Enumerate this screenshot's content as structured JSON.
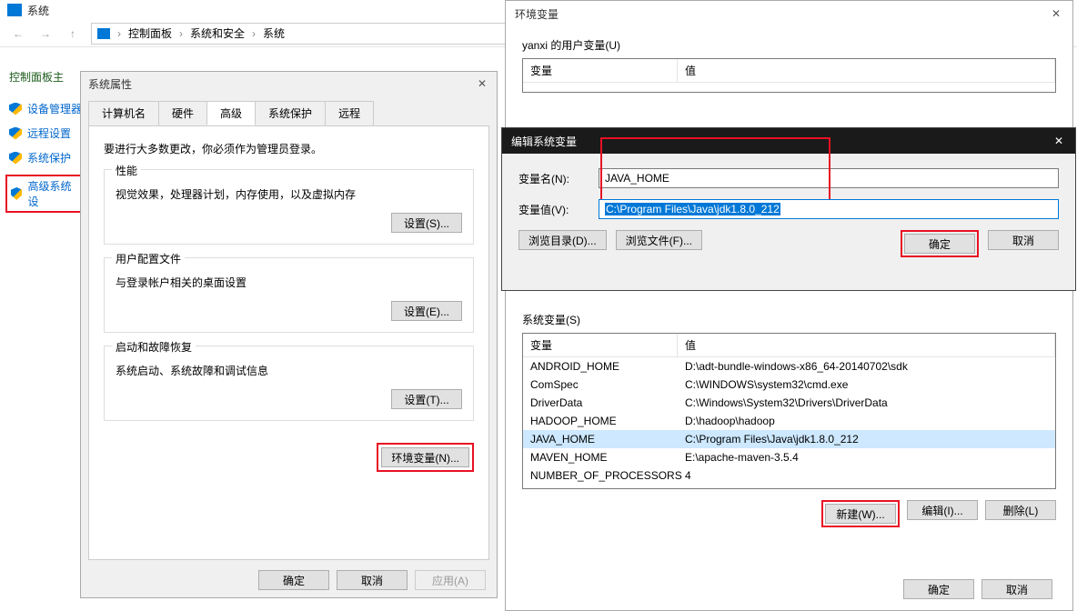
{
  "main": {
    "title": "系统",
    "path": [
      "控制面板",
      "系统和安全",
      "系统"
    ],
    "sidebar": {
      "heading": "控制面板主",
      "links": [
        "设备管理器",
        "远程设置",
        "系统保护",
        "高级系统设"
      ]
    }
  },
  "sysprops": {
    "title": "系统属性",
    "tabs": [
      "计算机名",
      "硬件",
      "高级",
      "系统保护",
      "远程"
    ],
    "notice": "要进行大多数更改，你必须作为管理员登录。",
    "groups": {
      "perf": {
        "title": "性能",
        "desc": "视觉效果，处理器计划，内存使用，以及虚拟内存",
        "btn": "设置(S)..."
      },
      "profile": {
        "title": "用户配置文件",
        "desc": "与登录帐户相关的桌面设置",
        "btn": "设置(E)..."
      },
      "startup": {
        "title": "启动和故障恢复",
        "desc": "系统启动、系统故障和调试信息",
        "btn": "设置(T)..."
      }
    },
    "env_btn": "环境变量(N)...",
    "ok": "确定",
    "cancel": "取消",
    "apply": "应用(A)"
  },
  "envvars": {
    "title": "环境变量",
    "user_section": "yanxi 的用户变量(U)",
    "col_name": "变量",
    "col_val": "值",
    "sys_section": "系统变量(S)",
    "sys_rows": [
      {
        "name": "ANDROID_HOME",
        "val": "D:\\adt-bundle-windows-x86_64-20140702\\sdk"
      },
      {
        "name": "ComSpec",
        "val": "C:\\WINDOWS\\system32\\cmd.exe"
      },
      {
        "name": "DriverData",
        "val": "C:\\Windows\\System32\\Drivers\\DriverData"
      },
      {
        "name": "HADOOP_HOME",
        "val": "D:\\hadoop\\hadoop"
      },
      {
        "name": "JAVA_HOME",
        "val": "C:\\Program Files\\Java\\jdk1.8.0_212"
      },
      {
        "name": "MAVEN_HOME",
        "val": "E:\\apache-maven-3.5.4"
      },
      {
        "name": "NUMBER_OF_PROCESSORS",
        "val": "4"
      }
    ],
    "new_btn": "新建(W)...",
    "edit_btn": "编辑(I)...",
    "del_btn": "删除(L)",
    "ok": "确定",
    "cancel": "取消"
  },
  "editvar": {
    "title": "编辑系统变量",
    "name_label": "变量名(N):",
    "name_value": "JAVA_HOME",
    "val_label": "变量值(V):",
    "val_value": "C:\\Program Files\\Java\\jdk1.8.0_212",
    "browse_dir": "浏览目录(D)...",
    "browse_file": "浏览文件(F)...",
    "ok": "确定",
    "cancel": "取消"
  }
}
